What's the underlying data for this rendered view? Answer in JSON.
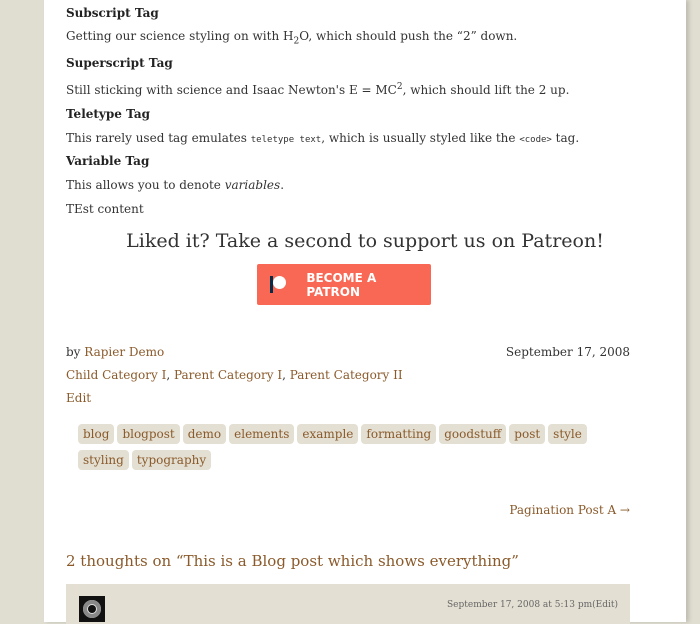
{
  "sections": {
    "subscript": {
      "title": "Subscript Tag",
      "before": "Getting our science styling on with H",
      "sub": "2",
      "after": "O, which should push the “2” down."
    },
    "superscript": {
      "title": "Superscript Tag",
      "before": "Still sticking with science and Isaac Newton's E = MC",
      "sup": "2",
      "after": ", which should lift the 2 up."
    },
    "teletype": {
      "title": "Teletype Tag",
      "before": "This rarely used tag emulates ",
      "tt": "teletype text",
      "middle": ", which is usually styled like the ",
      "code": "<code>",
      "after": " tag."
    },
    "variable": {
      "title": "Variable Tag",
      "before": "This allows you to denote ",
      "var": "variables",
      "after": "."
    },
    "test_content": "TEst content"
  },
  "patreon": {
    "heading": "Liked it? Take a second to support us on Patreon!",
    "button_label": "BECOME A PATRON",
    "button_color": "#f96854"
  },
  "post_meta": {
    "by": "by ",
    "author": "Rapier Demo",
    "date": "September 17, 2008",
    "categories": [
      "Child Category I",
      "Parent Category I",
      "Parent Category II"
    ],
    "edit": "Edit"
  },
  "tags": [
    "blog",
    "blogpost",
    "demo",
    "elements",
    "example",
    "formatting",
    "goodstuff",
    "post",
    "style",
    "styling",
    "typography"
  ],
  "pagination": {
    "next": "Pagination Post A →"
  },
  "comments": {
    "title": "2 thoughts on “This is a Blog post which shows everything”",
    "first": {
      "date": "September 17, 2008 at 5:13 pm",
      "edit": "(Edit)"
    }
  },
  "colors": {
    "accent": "#8a5a2b",
    "background": "#e0ddd1",
    "tag_bg": "#e3dfd2"
  }
}
